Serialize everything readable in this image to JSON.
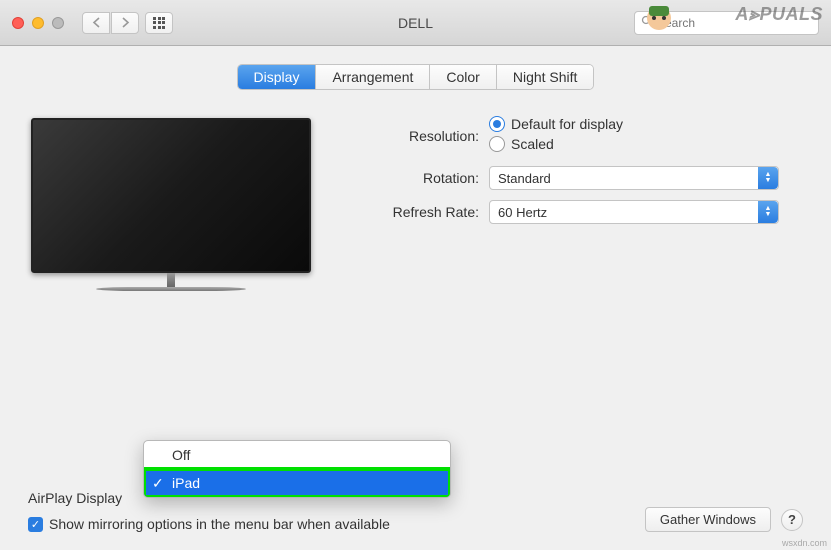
{
  "window": {
    "title": "DELL",
    "search_placeholder": "Search"
  },
  "tabs": {
    "display": "Display",
    "arrangement": "Arrangement",
    "color": "Color",
    "night_shift": "Night Shift"
  },
  "settings": {
    "resolution_label": "Resolution:",
    "resolution_default": "Default for display",
    "resolution_scaled": "Scaled",
    "rotation_label": "Rotation:",
    "rotation_value": "Standard",
    "refresh_label": "Refresh Rate:",
    "refresh_value": "60 Hertz"
  },
  "airplay": {
    "label": "AirPlay Display",
    "options": {
      "off": "Off",
      "ipad": "iPad"
    }
  },
  "mirror": {
    "label": "Show mirroring options in the menu bar when available"
  },
  "buttons": {
    "gather": "Gather Windows",
    "help": "?"
  },
  "watermark": {
    "main": "A⪢PUALS",
    "small": "wsxdn.com"
  }
}
